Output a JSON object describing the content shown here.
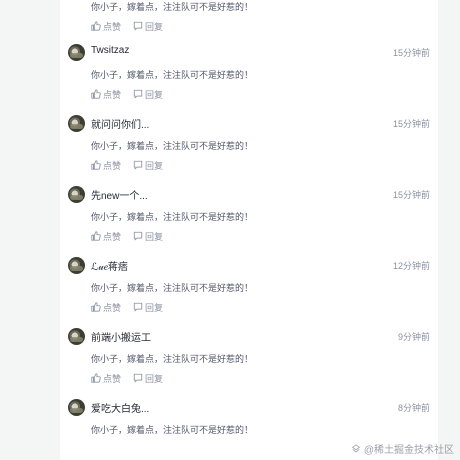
{
  "actions": {
    "like_label": "点赞",
    "reply_label": "回复"
  },
  "comments": [
    {
      "username": "",
      "time": "",
      "content": "你小子，嫁着点，注注队可不是好惹的！"
    },
    {
      "username": "Twsitzaz",
      "time": "15分钟前",
      "content": "你小子，嫁着点，注注队可不是好惹的！"
    },
    {
      "username": "就问问你们...",
      "time": "15分钟前",
      "content": "你小子，嫁着点，注注队可不是好惹的！"
    },
    {
      "username": "先new一个...",
      "time": "15分钟前",
      "content": "你小子，嫁着点，注注队可不是好惹的！"
    },
    {
      "username": "ℒ𝓊𝑒蒋痞",
      "time": "12分钟前",
      "content": "你小子，嫁着点，注注队可不是好惹的！"
    },
    {
      "username": "前端小搬运工",
      "time": "9分钟前",
      "content": "你小子，嫁着点，注注队可不是好惹的！"
    },
    {
      "username": "爱吃大白兔...",
      "time": "8分钟前",
      "content": "你小子，嫁着点，注注队可不是好惹的！"
    }
  ],
  "watermark": "@稀土掘金技术社区",
  "colors": {
    "page_bg": "#f4f5f5",
    "text_primary": "#252933",
    "text_secondary": "#8a919f"
  }
}
